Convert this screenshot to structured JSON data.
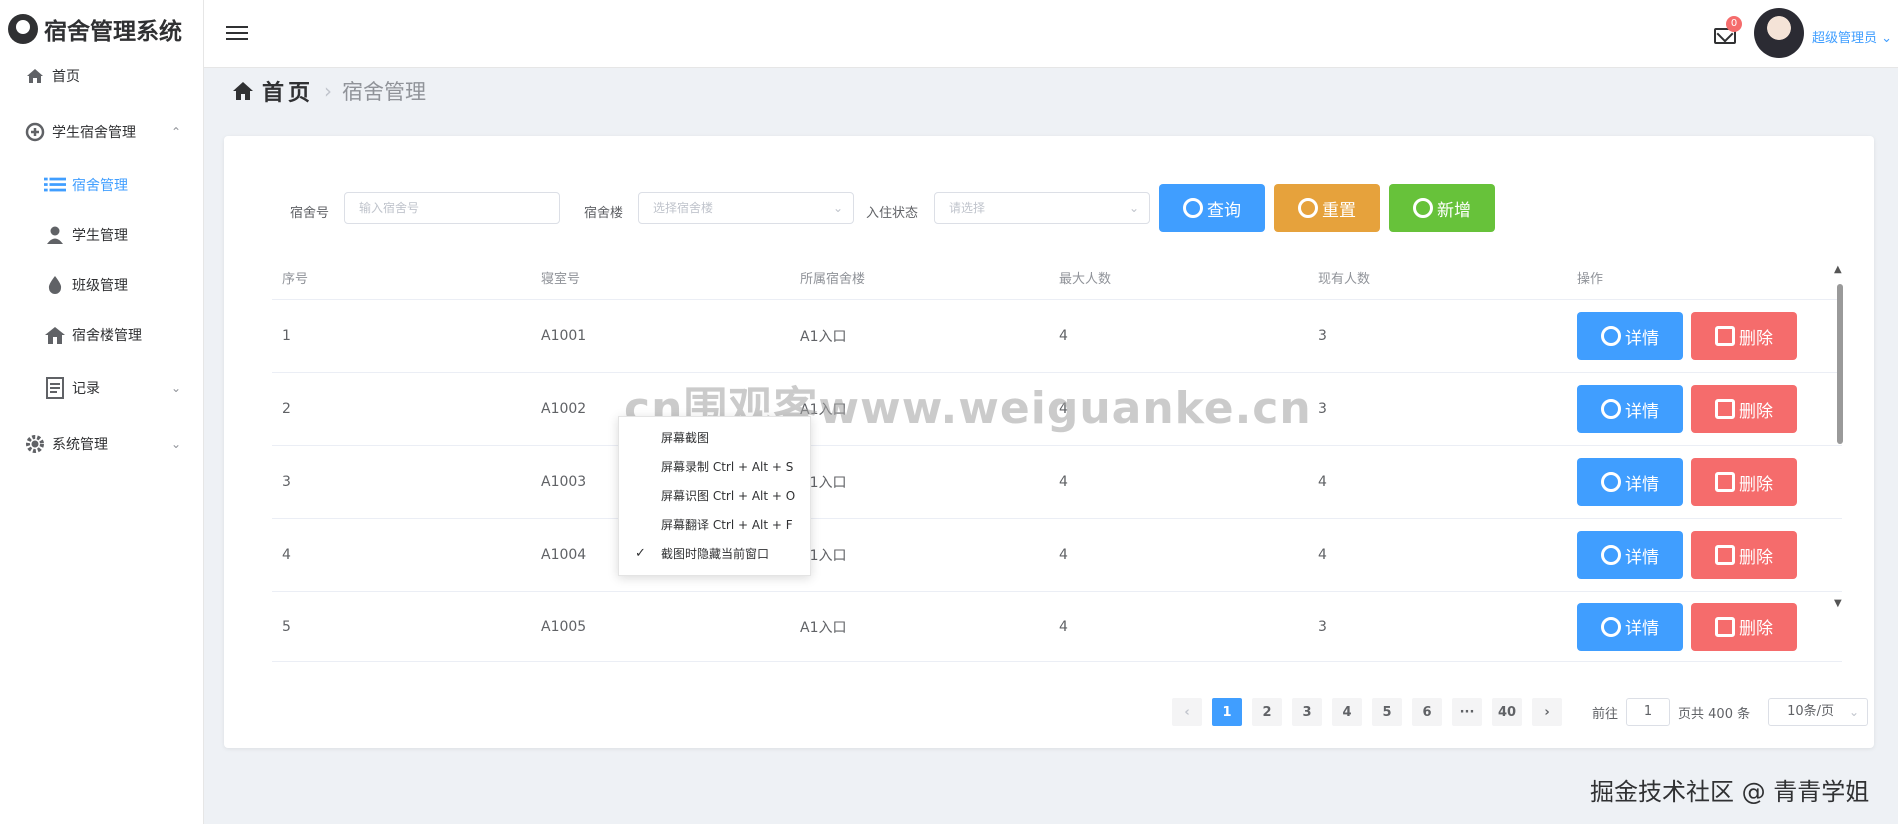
{
  "app": {
    "title": "宿舍管理系统"
  },
  "sidebar": {
    "items": [
      {
        "label": "首页",
        "icon": "home-icon"
      },
      {
        "label": "学生宿舍管理",
        "icon": "plus-circle-icon",
        "arrow": "⌃"
      },
      {
        "label": "宿舍管理",
        "icon": "list-icon"
      },
      {
        "label": "学生管理",
        "icon": "user-icon"
      },
      {
        "label": "班级管理",
        "icon": "drop-icon"
      },
      {
        "label": "宿舍楼管理",
        "icon": "house-icon"
      },
      {
        "label": "记录",
        "icon": "document-icon",
        "arrow": "⌄"
      },
      {
        "label": "系统管理",
        "icon": "gear-icon",
        "arrow": "⌄"
      }
    ]
  },
  "header": {
    "mail_badge": "0",
    "user_name": "超级管理员",
    "user_caret": "⌄"
  },
  "breadcrumb": {
    "home": "首页",
    "separator": "›",
    "current": "宿舍管理"
  },
  "search": {
    "room_label": "宿舍号",
    "room_placeholder": "输入宿舍号",
    "building_label": "宿舍楼",
    "building_placeholder": "选择宿舍楼",
    "status_label": "入住状态",
    "status_placeholder": "请选择",
    "query_button": "查询",
    "reset_button": "重置",
    "add_button": "新增"
  },
  "table": {
    "headers": [
      "序号",
      "寝室号",
      "所属宿舍楼",
      "最大人数",
      "现有人数",
      "操作"
    ],
    "rows": [
      {
        "index": "1",
        "room": "A1001",
        "building": "A1入口",
        "max": "4",
        "current": "3"
      },
      {
        "index": "2",
        "room": "A1002",
        "building": "A1入口",
        "max": "4",
        "current": "3"
      },
      {
        "index": "3",
        "room": "A1003",
        "building": "A1入口",
        "max": "4",
        "current": "4"
      },
      {
        "index": "4",
        "room": "A1004",
        "building": "A1入口",
        "max": "4",
        "current": "4"
      },
      {
        "index": "5",
        "room": "A1005",
        "building": "A1入口",
        "max": "4",
        "current": "3"
      }
    ],
    "detail_label": "详情",
    "delete_label": "删除"
  },
  "pagination": {
    "prev": "‹",
    "next": "›",
    "pages": [
      "1",
      "2",
      "3",
      "4",
      "5",
      "6",
      "···",
      "40"
    ],
    "active_page": "1",
    "goto_label": "前往",
    "goto_value": "1",
    "total_text": "页共 400 条",
    "page_size": "10条/页"
  },
  "context_menu": {
    "items": [
      {
        "label": "屏幕截图",
        "checked": false
      },
      {
        "label": "屏幕录制 Ctrl + Alt + S",
        "checked": false
      },
      {
        "label": "屏幕识图 Ctrl + Alt + O",
        "checked": false
      },
      {
        "label": "屏幕翻译 Ctrl + Alt + F",
        "checked": false
      },
      {
        "label": "截图时隐藏当前窗口",
        "checked": true
      }
    ],
    "check_mark": "✓"
  },
  "watermarks": {
    "center": "cn围观客www.weiguanke.cn",
    "bottom_right": "掘金技术社区 @ 青青学姐"
  },
  "colors": {
    "primary": "#409eff",
    "warning": "#e6a23c",
    "success": "#67c23a",
    "danger": "#f56c6c"
  }
}
